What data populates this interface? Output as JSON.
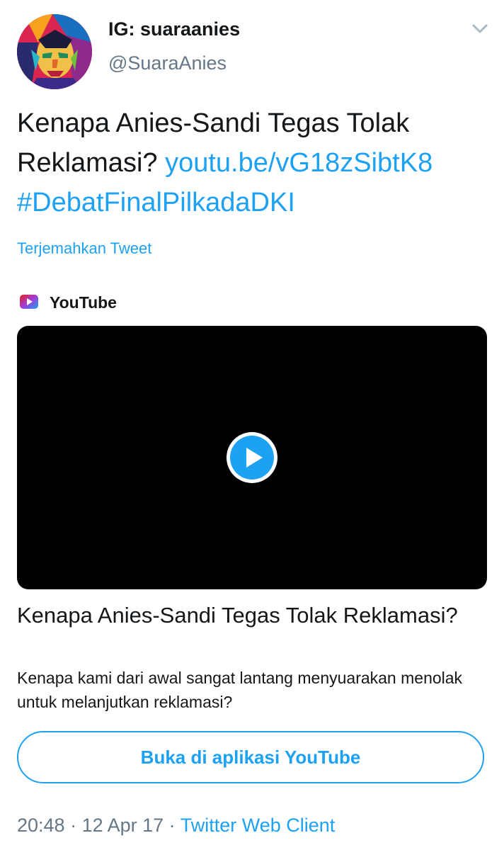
{
  "author": {
    "display_name": "IG: suaraanies",
    "handle": "@SuaraAnies",
    "avatar_icon": "avatar-portrait"
  },
  "tweet": {
    "text": "Kenapa Anies-Sandi Tegas Tolak Reklamasi?",
    "link": "youtu.be/vG18zSibtK8",
    "hashtag": "#DebatFinalPilkadaDKI",
    "translate_label": "Terjemahkan Tweet"
  },
  "card": {
    "provider": "YouTube",
    "provider_icon": "youtube-icon",
    "play_icon": "play-icon",
    "title": "Kenapa Anies-Sandi Tegas Tolak Reklamasi?",
    "description": "Kenapa kami dari awal sangat lantang menyuarakan menolak untuk melanjutkan reklamasi?",
    "open_button_label": "Buka di aplikasi YouTube"
  },
  "meta": {
    "time": "20:48",
    "separator": " · ",
    "date": "12 Apr 17",
    "source": "Twitter Web Client"
  },
  "colors": {
    "link": "#1da1f2",
    "text": "#14171a",
    "secondary": "#657786"
  }
}
